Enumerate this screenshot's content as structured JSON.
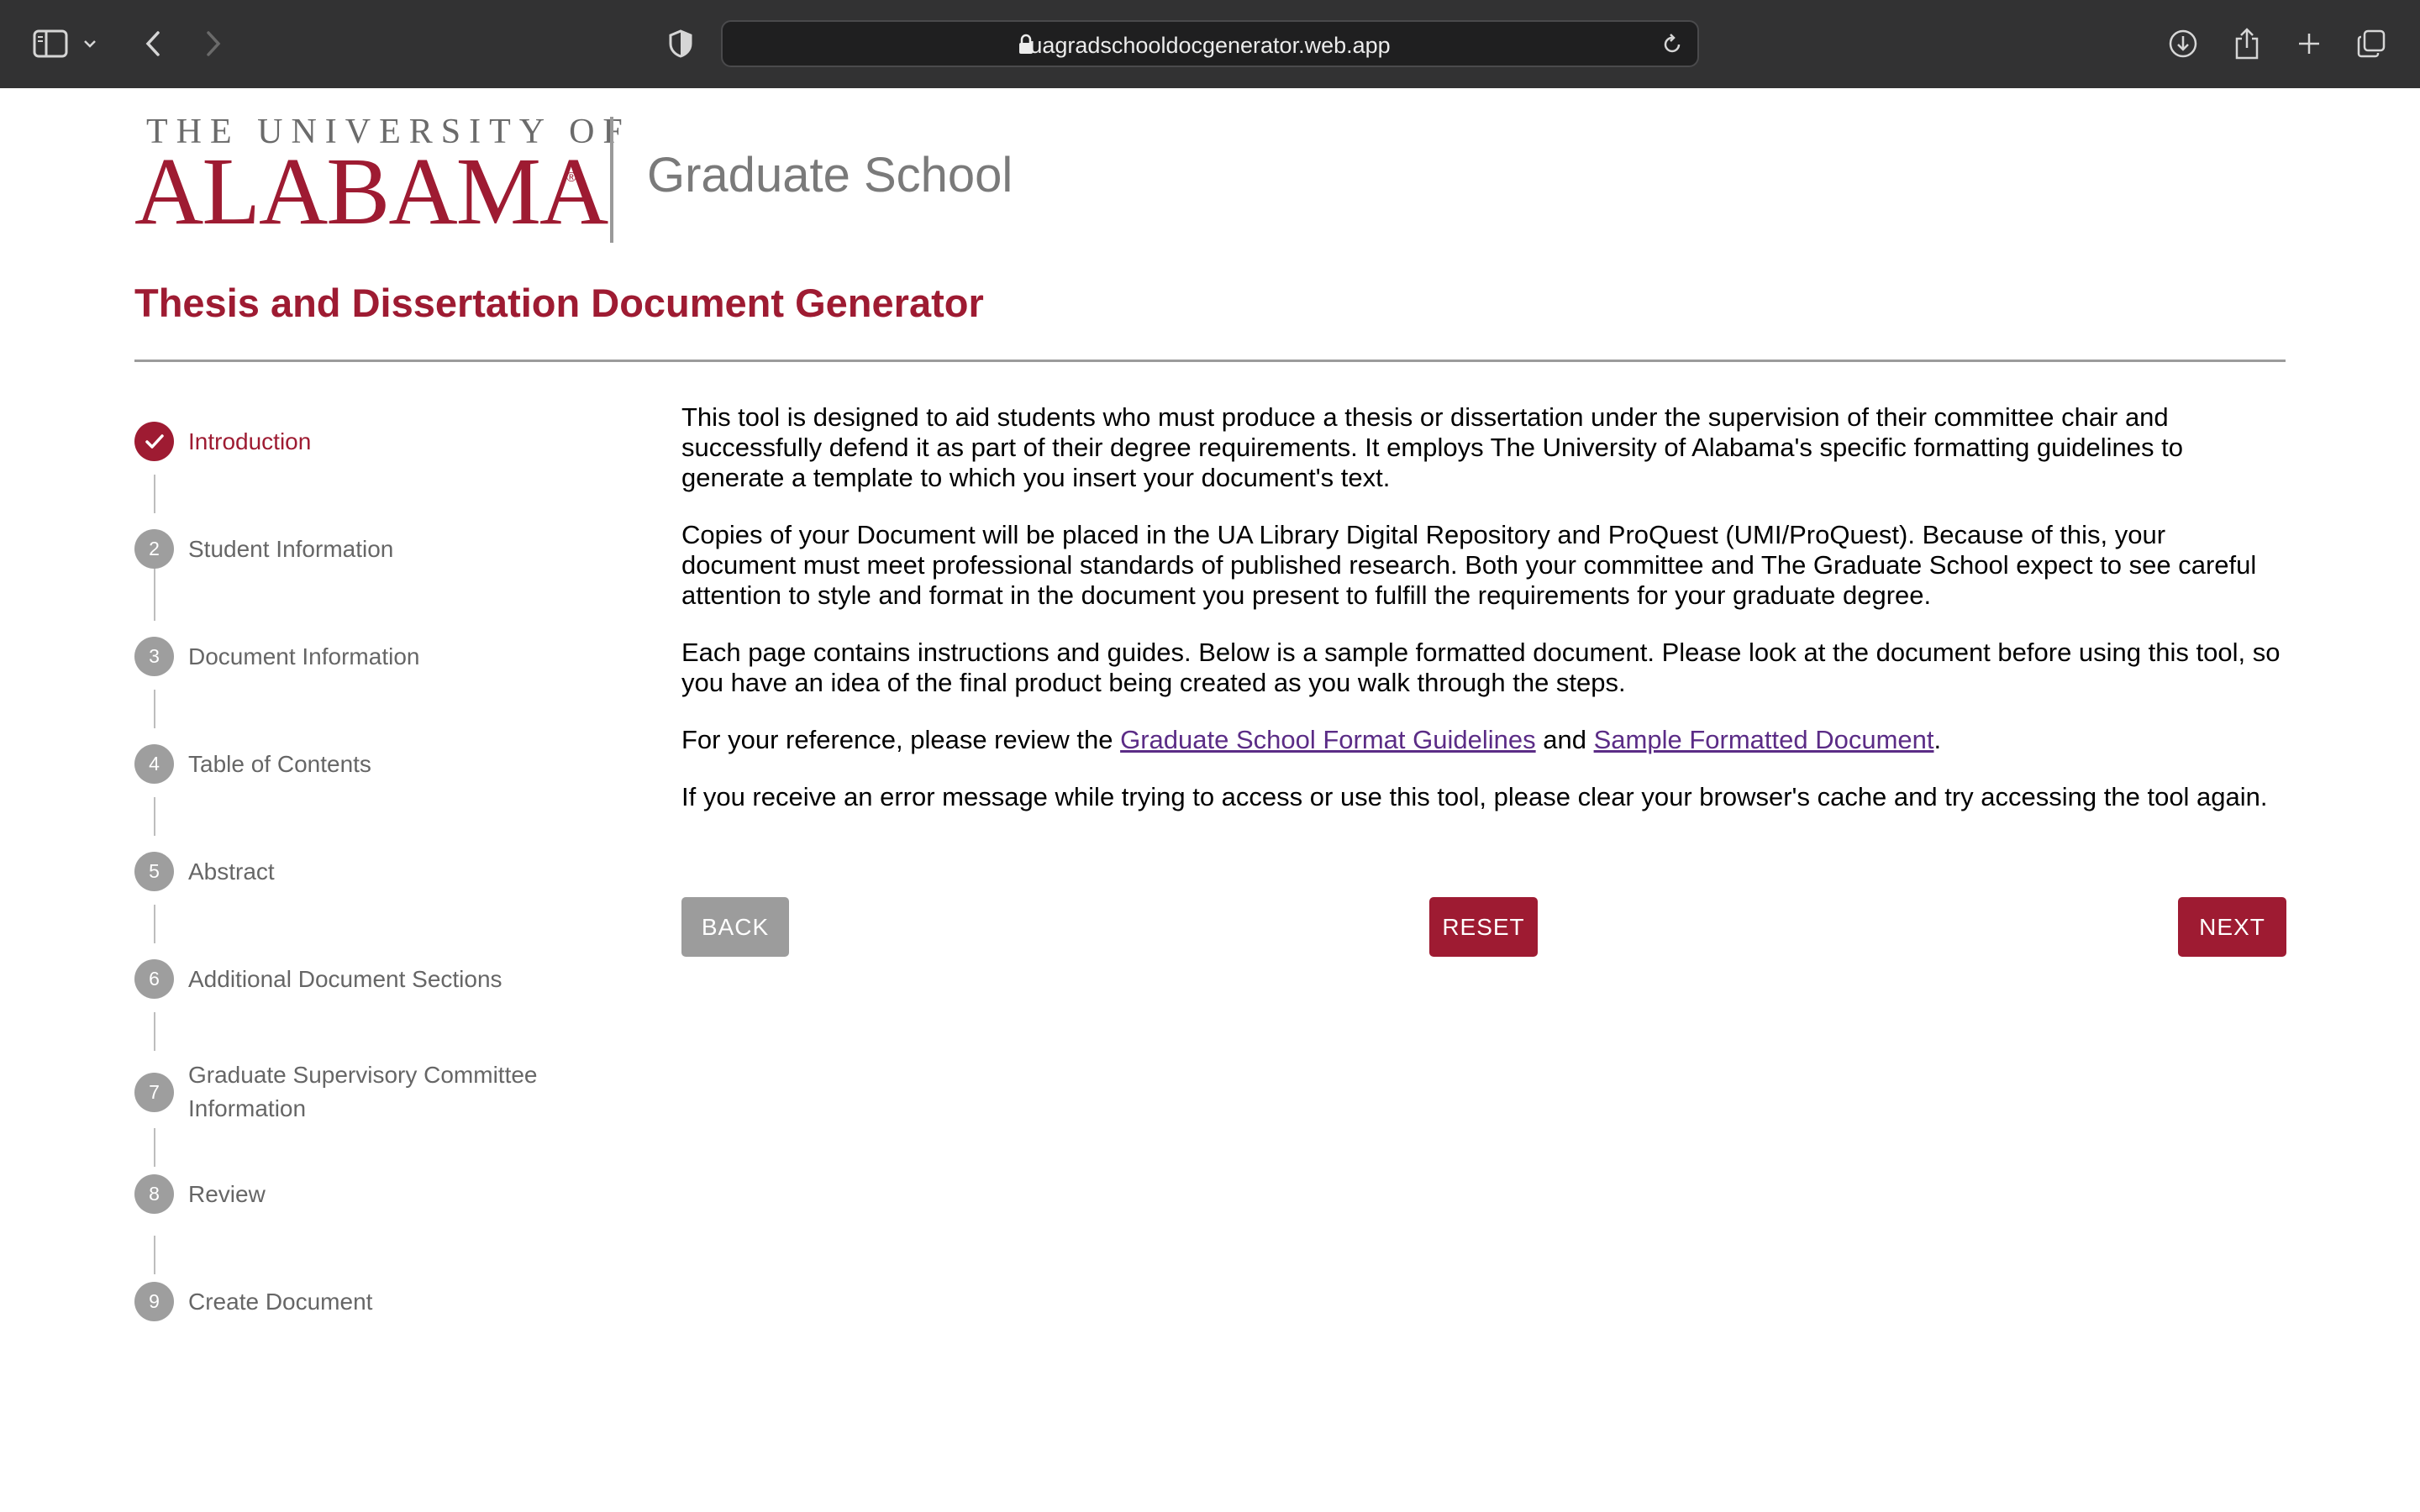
{
  "browser": {
    "url": "uagradschooldocgenerator.web.app"
  },
  "header": {
    "logo_top": "THE UNIVERSITY OF",
    "logo_main": "ALABAMA",
    "logo_reg": "®",
    "logo_unit": "Graduate School",
    "title": "Thesis and Dissertation Document Generator"
  },
  "stepper": {
    "steps": [
      {
        "number": "",
        "label": "Introduction",
        "status": "completed"
      },
      {
        "number": "2",
        "label": "Student Information"
      },
      {
        "number": "3",
        "label": "Document Information"
      },
      {
        "number": "4",
        "label": "Table of Contents"
      },
      {
        "number": "5",
        "label": "Abstract"
      },
      {
        "number": "6",
        "label": "Additional Document Sections"
      },
      {
        "number": "7",
        "label_line1": "Graduate Supervisory Committee",
        "label_line2": "Information"
      },
      {
        "number": "8",
        "label": "Review"
      },
      {
        "number": "9",
        "label": "Create Document"
      }
    ]
  },
  "content": {
    "p1": "This tool is designed to aid students who must produce a thesis or dissertation under the supervision of their committee chair and successfully defend it as part of their degree requirements. It employs The University of Alabama's specific formatting guidelines to generate a template to which you insert your document's text.",
    "p2": "Copies of your Document will be placed in the UA Library Digital Repository and ProQuest (UMI/ProQuest). Because of this, your document must meet professional standards of published research. Both your committee and The Graduate School expect to see careful attention to style and format in the document you present to fulfill the requirements for your graduate degree.",
    "p3": "Each page contains instructions and guides. Below is a sample formatted document. Please look at the document before using this tool, so you have an idea of the final product being created as you walk through the steps.",
    "p4_prefix": "For your reference, please review the ",
    "p4_link1": "Graduate School Format Guidelines",
    "p4_mid": " and ",
    "p4_link2": "Sample Formatted Document",
    "p4_suffix": ".",
    "p5": "If you receive an error message while trying to access or use this tool, please clear your browser's cache and try accessing the tool again."
  },
  "buttons": {
    "back": "BACK",
    "reset": "RESET",
    "next": "NEXT"
  },
  "colors": {
    "brand": "#9e1b32",
    "link": "#5b2c86",
    "disabled": "#9c9c9c"
  }
}
